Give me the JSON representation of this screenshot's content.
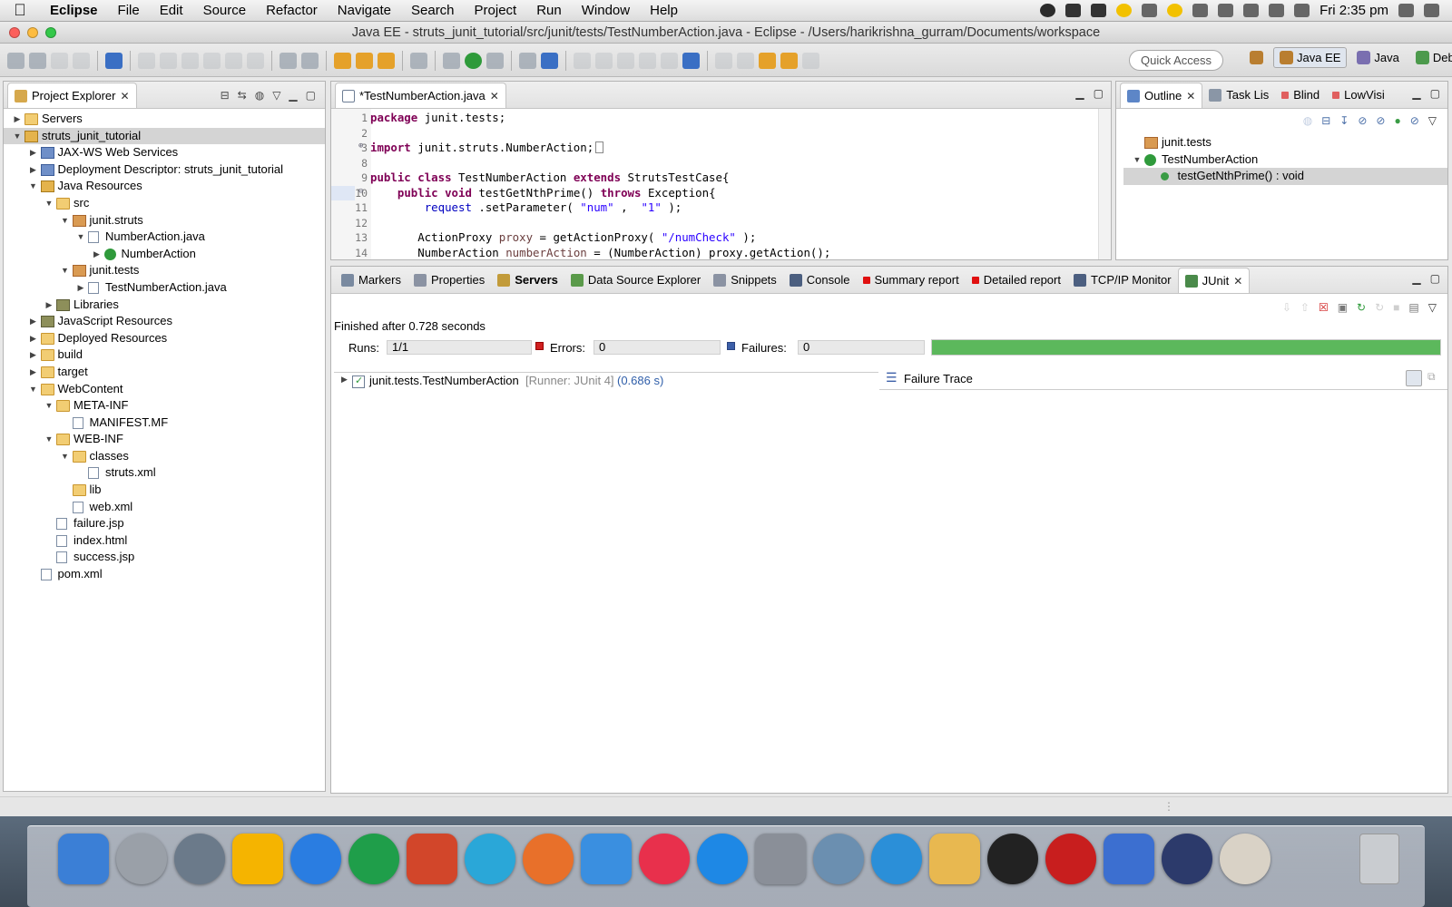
{
  "menubar": {
    "app": "Eclipse",
    "items": [
      "File",
      "Edit",
      "Source",
      "Refactor",
      "Navigate",
      "Search",
      "Project",
      "Run",
      "Window",
      "Help"
    ],
    "clock": "Fri 2:35 pm"
  },
  "window": {
    "title": "Java EE - struts_junit_tutorial/src/junit/tests/TestNumberAction.java - Eclipse - /Users/harikrishna_gurram/Documents/workspace"
  },
  "toolbar": {
    "quick_access": "Quick Access",
    "perspectives": [
      "Java EE",
      "Java",
      "Debug"
    ]
  },
  "explorer": {
    "tab": "Project Explorer",
    "items": [
      {
        "label": "Servers",
        "depth": 0,
        "twisty": "closed",
        "icon": "folder"
      },
      {
        "label": "struts_junit_tutorial",
        "depth": 0,
        "twisty": "open",
        "icon": "proj",
        "selected": true
      },
      {
        "label": "JAX-WS Web Services",
        "depth": 1,
        "twisty": "closed",
        "icon": "svc"
      },
      {
        "label": "Deployment Descriptor: struts_junit_tutorial",
        "depth": 1,
        "twisty": "closed",
        "icon": "svc"
      },
      {
        "label": "Java Resources",
        "depth": 1,
        "twisty": "open",
        "icon": "proj"
      },
      {
        "label": "src",
        "depth": 2,
        "twisty": "open",
        "icon": "folder"
      },
      {
        "label": "junit.struts",
        "depth": 3,
        "twisty": "open",
        "icon": "pkg"
      },
      {
        "label": "NumberAction.java",
        "depth": 4,
        "twisty": "open",
        "icon": "file"
      },
      {
        "label": "NumberAction",
        "depth": 5,
        "twisty": "closed",
        "icon": "class"
      },
      {
        "label": "junit.tests",
        "depth": 3,
        "twisty": "open",
        "icon": "pkg"
      },
      {
        "label": "TestNumberAction.java",
        "depth": 4,
        "twisty": "closed",
        "icon": "file"
      },
      {
        "label": "Libraries",
        "depth": 2,
        "twisty": "closed",
        "icon": "lib"
      },
      {
        "label": "JavaScript Resources",
        "depth": 1,
        "twisty": "closed",
        "icon": "lib"
      },
      {
        "label": "Deployed Resources",
        "depth": 1,
        "twisty": "closed",
        "icon": "folder"
      },
      {
        "label": "build",
        "depth": 1,
        "twisty": "closed",
        "icon": "folder"
      },
      {
        "label": "target",
        "depth": 1,
        "twisty": "closed",
        "icon": "folder"
      },
      {
        "label": "WebContent",
        "depth": 1,
        "twisty": "open",
        "icon": "folder"
      },
      {
        "label": "META-INF",
        "depth": 2,
        "twisty": "open",
        "icon": "folder"
      },
      {
        "label": "MANIFEST.MF",
        "depth": 3,
        "twisty": "none",
        "icon": "file"
      },
      {
        "label": "WEB-INF",
        "depth": 2,
        "twisty": "open",
        "icon": "folder"
      },
      {
        "label": "classes",
        "depth": 3,
        "twisty": "open",
        "icon": "folder"
      },
      {
        "label": "struts.xml",
        "depth": 4,
        "twisty": "none",
        "icon": "file"
      },
      {
        "label": "lib",
        "depth": 3,
        "twisty": "none",
        "icon": "folder"
      },
      {
        "label": "web.xml",
        "depth": 3,
        "twisty": "none",
        "icon": "file"
      },
      {
        "label": "failure.jsp",
        "depth": 2,
        "twisty": "none",
        "icon": "file"
      },
      {
        "label": "index.html",
        "depth": 2,
        "twisty": "none",
        "icon": "file"
      },
      {
        "label": "success.jsp",
        "depth": 2,
        "twisty": "none",
        "icon": "file"
      },
      {
        "label": "pom.xml",
        "depth": 1,
        "twisty": "none",
        "icon": "file"
      }
    ]
  },
  "editor": {
    "tab": "*TestNumberAction.java",
    "lines": [
      {
        "n": "1",
        "segs": [
          [
            "kw",
            "package"
          ],
          [
            "",
            "junit.tests;"
          ]
        ]
      },
      {
        "n": "2",
        "segs": []
      },
      {
        "n": "3",
        "segs": [
          [
            "kw",
            "import"
          ],
          [
            "",
            "junit.struts.NumberAction;"
          ]
        ],
        "fold": "plus"
      },
      {
        "n": "8",
        "segs": []
      },
      {
        "n": "9",
        "segs": [
          [
            "kw",
            "public"
          ],
          [
            "kw",
            "class"
          ],
          [
            "",
            "TestNumberAction"
          ],
          [
            "kw",
            "extends"
          ],
          [
            "",
            "StrutsTestCase{"
          ]
        ]
      },
      {
        "n": "10",
        "segs": [
          [
            "",
            "   "
          ],
          [
            "kw",
            "public"
          ],
          [
            "kw",
            "void"
          ],
          [
            "",
            "testGetNthPrime()"
          ],
          [
            "kw",
            "throws"
          ],
          [
            "",
            "Exception{"
          ]
        ],
        "fold": "minus"
      },
      {
        "n": "11",
        "segs": [
          [
            "",
            "       "
          ],
          [
            "fld",
            "request"
          ],
          [
            "",
            ".setParameter("
          ],
          [
            "str",
            "\"num\""
          ],
          [
            "",
            ", "
          ],
          [
            "str",
            "\"1\""
          ],
          [
            "",
            ");"
          ]
        ]
      },
      {
        "n": "12",
        "segs": []
      },
      {
        "n": "13",
        "segs": [
          [
            "",
            "       ActionProxy"
          ],
          [
            "var",
            "proxy"
          ],
          [
            "",
            "= getActionProxy("
          ],
          [
            "str",
            "\"/numCheck\""
          ],
          [
            "",
            ");"
          ]
        ]
      },
      {
        "n": "14",
        "segs": [
          [
            "",
            "       NumberAction"
          ],
          [
            "var",
            "numberAction"
          ],
          [
            "",
            "= (NumberAction) proxy.getAction();"
          ]
        ]
      }
    ]
  },
  "outline": {
    "tabs": [
      "Outline",
      "Task Lis",
      "Blind",
      "LowVisi"
    ],
    "items": [
      {
        "label": "junit.tests",
        "depth": 0,
        "twisty": "none",
        "icon": "pkg"
      },
      {
        "label": "TestNumberAction",
        "depth": 0,
        "twisty": "open",
        "icon": "class"
      },
      {
        "label": "testGetNthPrime() : void",
        "depth": 1,
        "twisty": "none",
        "icon": "green",
        "selected": true
      }
    ]
  },
  "bottom": {
    "tabs": [
      "Markers",
      "Properties",
      "Servers",
      "Data Source Explorer",
      "Snippets",
      "Console",
      "Summary report",
      "Detailed report",
      "TCP/IP Monitor",
      "JUnit"
    ],
    "finished": "Finished after 0.728 seconds",
    "runs_label": "Runs:",
    "runs": "1/1",
    "errors_label": "Errors:",
    "errors": "0",
    "failures_label": "Failures:",
    "failures": "0",
    "progress": 1.0,
    "progress_color": "#5cb85c",
    "result": {
      "name": "junit.tests.TestNumberAction",
      "runner": "[Runner: JUnit 4]",
      "time": "(0.686 s)"
    },
    "failure_trace": "Failure Trace"
  }
}
